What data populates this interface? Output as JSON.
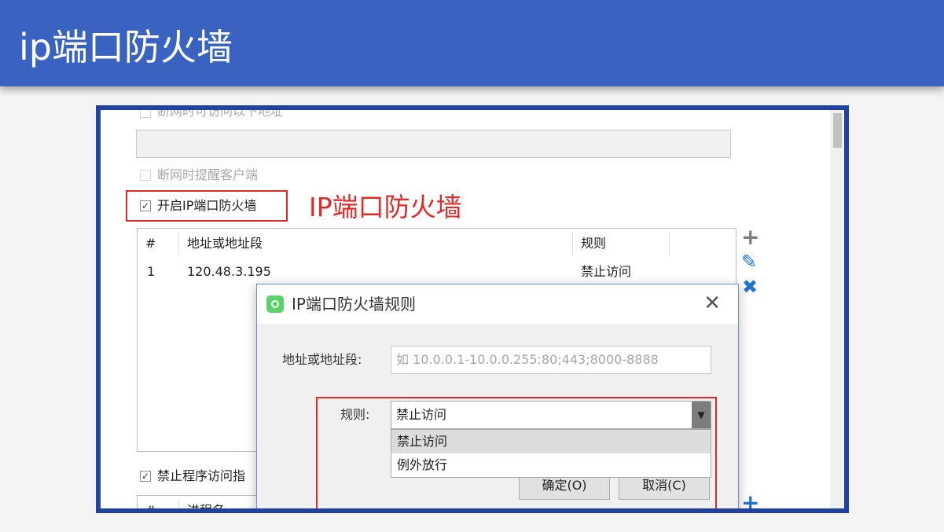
{
  "slide": {
    "title": "ip端口防火墙"
  },
  "screenshot": {
    "checkbox_disconnect_allow": "断网时可访问以下地址",
    "checkbox_remind_client": "断网时提醒客户端",
    "checkbox_ip_firewall": "开启IP端口防火墙",
    "checkmark": "✓",
    "annotation": "IP端口防火墙",
    "ip_table": {
      "columns": [
        "#",
        "地址或地址段",
        "规则"
      ],
      "rows": [
        {
          "index": "1",
          "address": "120.48.3.195",
          "rule": "禁止访问"
        }
      ]
    },
    "side_buttons": {
      "add": "+",
      "edit": "✎",
      "delete": "✖"
    },
    "checkbox_block_program": "禁止程序访问指",
    "program_table": {
      "columns": [
        "#",
        "进程名"
      ]
    },
    "dialog": {
      "title": "IP端口防火墙规则",
      "close": "✕",
      "address_label": "地址或地址段:",
      "address_placeholder": "如 10.0.0.1-10.0.0.255:80;443;8000-8888",
      "rule_label": "规则:",
      "rule_value": "禁止访问",
      "rule_arrow": "▼",
      "rule_options": [
        "禁止访问",
        "例外放行"
      ],
      "ok_label": "确定(O)",
      "cancel_label": "取消(C)"
    }
  },
  "colors": {
    "banner": "#3a62c0",
    "frame": "#2143a0",
    "highlight": "#e02a2a",
    "icon_blue": "#1f73d1",
    "icon_gray": "#7f7f7f",
    "app_icon": "#5bd36a"
  }
}
